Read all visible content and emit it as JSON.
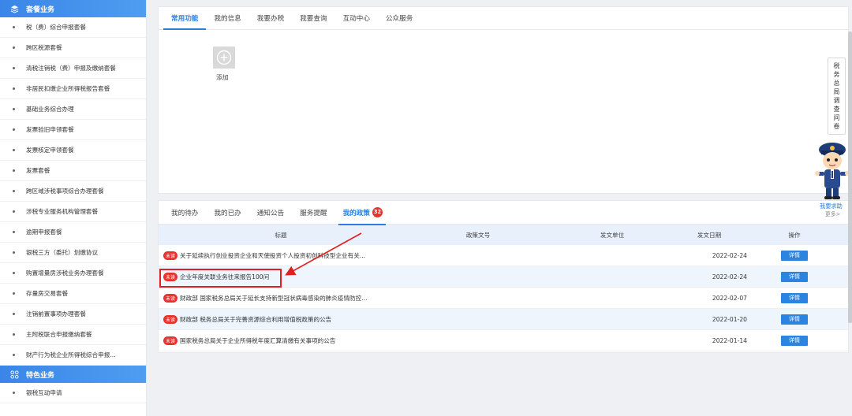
{
  "sidebar": {
    "group1": {
      "title": "套餐业务",
      "icon": "layers-icon"
    },
    "items": [
      "税（费）综合申报套餐",
      "跨区税源套餐",
      "清税注销税（费）申报及缴纳套餐",
      "非居民扣缴企业所得税报告套餐",
      "基础业务综合办理",
      "发票验旧申领套餐",
      "发票核定申领套餐",
      "发票套餐",
      "跨区域涉税事项综合办理套餐",
      "涉税专业服务机构管理套餐",
      "逾期申报套餐",
      "银税三方（委托）划缴协议",
      "购置增量房涉税业务办理套餐",
      "存量房交易套餐",
      "注销前置事项办理套餐",
      "主附税联合申报缴纳套餐",
      "财产行为税企业所得税综合申报..."
    ],
    "group2": {
      "title": "特色业务",
      "icon": "grid-icon"
    },
    "items2": [
      "银税互动申请"
    ]
  },
  "top_tabs": [
    "常用功能",
    "我的信息",
    "我要办税",
    "我要查询",
    "互动中心",
    "公众服务"
  ],
  "top_active_tab": "常用功能",
  "add_label": "添加",
  "bottom_tabs": [
    "我的待办",
    "我的已办",
    "通知公告",
    "服务提醒",
    "我的政策"
  ],
  "bottom_active_tab": "我的政策",
  "policy_badge": "32",
  "table": {
    "headers": {
      "title": "标题",
      "doc_no": "政策文号",
      "issuer": "发文单位",
      "date": "发文日期",
      "op": "操作"
    },
    "unread_label": "未读",
    "detail_label": "详情",
    "rows": [
      {
        "title": "关于延续执行创业投资企业和天使投资个人投资初创科技型企业有关...",
        "doc_no": "",
        "issuer": "",
        "date": "2022-02-24"
      },
      {
        "title": "企业年度关联业务往来报告100问",
        "doc_no": "",
        "issuer": "",
        "date": "2022-02-24"
      },
      {
        "title": "财政部 国家税务总局关于延长支持新型冠状病毒感染的肺炎疫情防控...",
        "doc_no": "",
        "issuer": "",
        "date": "2022-02-07"
      },
      {
        "title": "财政部 税务总局关于完善资源综合利用增值税政策的公告",
        "doc_no": "",
        "issuer": "",
        "date": "2022-01-20"
      },
      {
        "title": "国家税务总局关于企业所得税年度汇算清缴有关事项的公告",
        "doc_no": "",
        "issuer": "",
        "date": "2022-01-14"
      }
    ]
  },
  "right": {
    "survey": [
      "税",
      "务",
      "总",
      "局",
      "调",
      "查",
      "问",
      "卷"
    ],
    "help": "我要求助",
    "more": "更多>"
  },
  "colors": {
    "accent": "#2b7fdb",
    "sidebar_header": "#3a86e8",
    "unread": "#e8322c",
    "annotation": "#e02020"
  }
}
